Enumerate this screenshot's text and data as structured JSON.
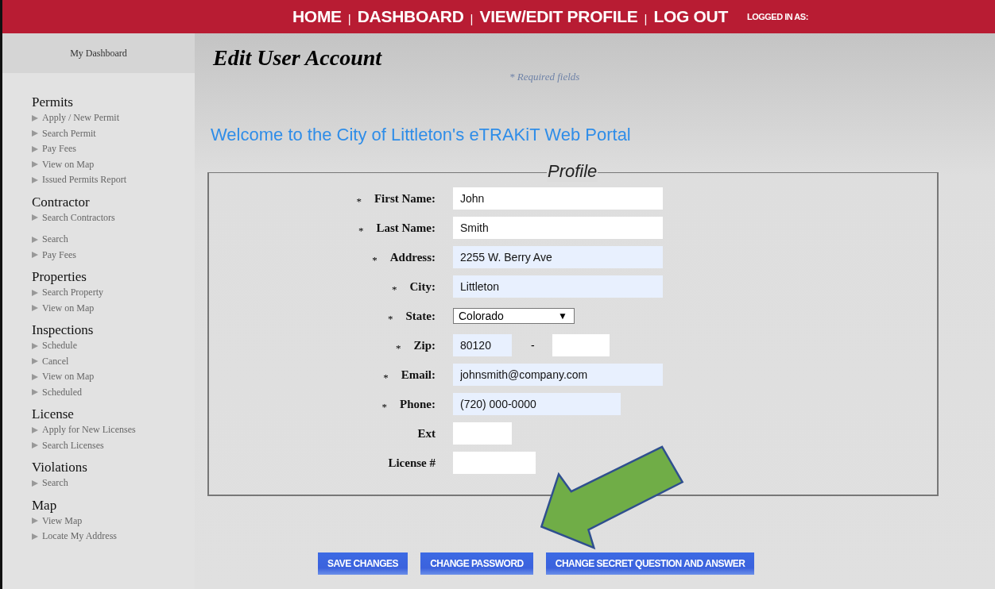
{
  "top_nav": {
    "links": [
      "HOME",
      "DASHBOARD",
      "VIEW/EDIT PROFILE",
      "LOG OUT"
    ],
    "separator": "|",
    "logged_in": "LOGGED IN AS:"
  },
  "sidebar": {
    "header": "My Dashboard",
    "sections": [
      {
        "title": "Permits",
        "items": [
          {
            "label": "Apply / New Permit"
          },
          {
            "label": "Search Permit"
          },
          {
            "label": "Pay Fees"
          },
          {
            "label": "View on Map"
          },
          {
            "label": "Issued Permits Report"
          }
        ]
      },
      {
        "title": "Contractor",
        "items": [
          {
            "label": "Search Contractors"
          }
        ]
      },
      {
        "items": [
          {
            "label": "Search"
          },
          {
            "label": "Pay Fees"
          }
        ]
      },
      {
        "title": "Properties",
        "items": [
          {
            "label": "Search Property"
          },
          {
            "label": "View on Map"
          }
        ]
      },
      {
        "title": "Inspections",
        "items": [
          {
            "label": "Schedule"
          },
          {
            "label": "Cancel"
          },
          {
            "label": "View on Map"
          },
          {
            "label": "Scheduled"
          }
        ]
      },
      {
        "title": "License",
        "items": [
          {
            "label": "Apply for New Licenses"
          },
          {
            "label": "Search Licenses"
          }
        ]
      },
      {
        "title": "Violations",
        "items": [
          {
            "label": "Search"
          }
        ]
      },
      {
        "title": "Map",
        "items": [
          {
            "label": "View Map"
          },
          {
            "label": "Locate My Address"
          }
        ]
      }
    ]
  },
  "page_title": "Edit User Account",
  "required_note": "* Required fields",
  "welcome": "Welcome to the City of Littleton's eTRAKiT Web Portal",
  "profile": {
    "legend": "Profile",
    "required_mark": "*",
    "fields": [
      {
        "label": "First Name:",
        "kind": "long",
        "required": true,
        "highlighted": false,
        "value": "John"
      },
      {
        "label": "Last Name:",
        "kind": "long",
        "required": true,
        "highlighted": false,
        "value": "Smith"
      },
      {
        "label": "Address:",
        "kind": "long",
        "required": true,
        "highlighted": true,
        "value": "2255 W. Berry Ave"
      },
      {
        "label": "City:",
        "kind": "long",
        "required": true,
        "highlighted": true,
        "value": "Littleton"
      },
      {
        "label": "State:",
        "kind": "select",
        "required": true,
        "highlighted": false,
        "value": "Colorado",
        "caret": "▼"
      },
      {
        "label": "Zip:",
        "kind": "zip",
        "required": true,
        "highlighted": true,
        "value": "80120",
        "separator": "-"
      },
      {
        "label": "Email:",
        "kind": "long",
        "required": true,
        "highlighted": true,
        "value": "johnsmith@company.com"
      },
      {
        "label": "Phone:",
        "kind": "medium",
        "required": true,
        "highlighted": true,
        "value": "(720) 000-0000"
      },
      {
        "label": "Ext",
        "kind": "short",
        "required": false,
        "highlighted": false
      },
      {
        "label": "License #",
        "kind": "partial",
        "required": false,
        "highlighted": false
      }
    ]
  },
  "buttons": [
    "SAVE CHANGES",
    "CHANGE PASSWORD",
    "CHANGE SECRET QUESTION AND ANSWER"
  ]
}
